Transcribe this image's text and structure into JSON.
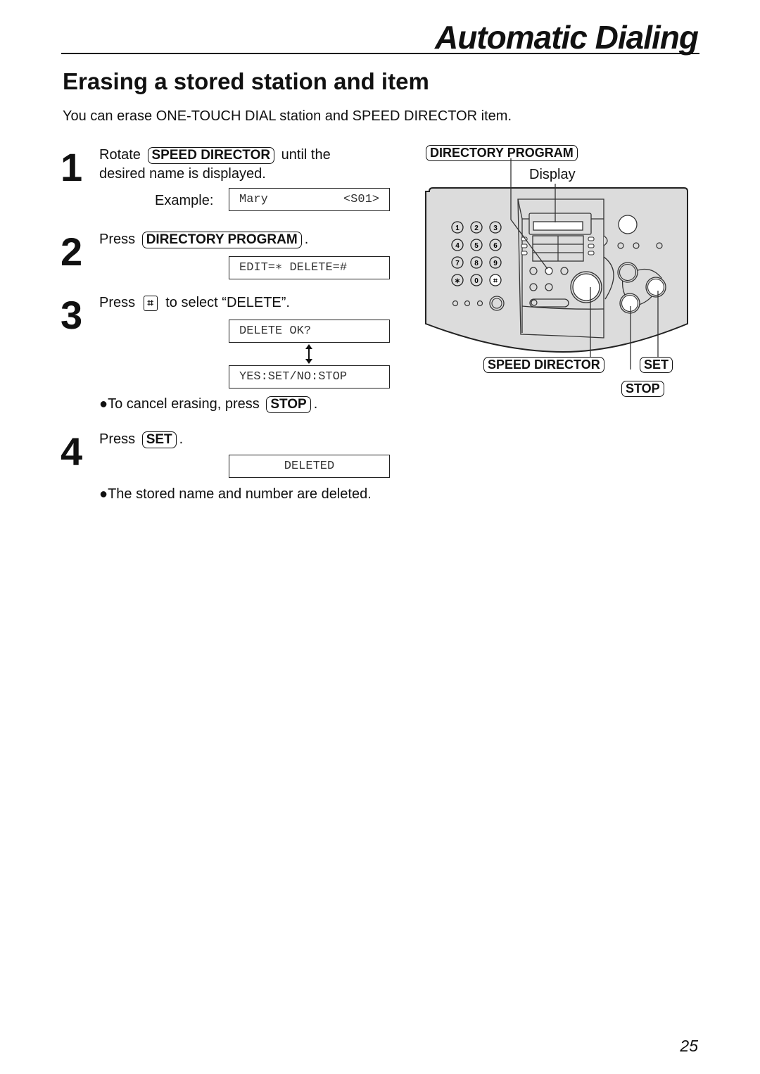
{
  "header": {
    "title": "Automatic Dialing"
  },
  "section": {
    "title": "Erasing a stored station and item",
    "intro": "You can erase ONE-TOUCH DIAL station and SPEED DIRECTOR item."
  },
  "steps": [
    {
      "number": "1",
      "text_before": "Rotate",
      "key": "SPEED DIRECTOR",
      "text_after": "until the",
      "line2": "desired name is displayed.",
      "example_label": "Example:",
      "display": {
        "left": "Mary",
        "right": "<S01>"
      }
    },
    {
      "number": "2",
      "text_before": "Press",
      "key": "DIRECTORY PROGRAM",
      "text_after": ".",
      "display": "EDIT=∗ DELETE=#"
    },
    {
      "number": "3",
      "text_before": "Press",
      "key": "⌗",
      "text_after": "to select “DELETE”.",
      "display_1": "DELETE OK?",
      "display_2": "YES:SET/NO:STOP",
      "note_before": "●To cancel erasing, press",
      "note_key": "STOP",
      "note_after": "."
    },
    {
      "number": "4",
      "text_before": "Press",
      "key": "SET",
      "text_after": ".",
      "display": "DELETED",
      "note": "●The stored name and number are deleted."
    }
  ],
  "diagram": {
    "labels": {
      "directory_program": "DIRECTORY PROGRAM",
      "display": "Display",
      "speed_director": "SPEED DIRECTOR",
      "set": "SET",
      "stop": "STOP"
    },
    "keypad": [
      "1",
      "2",
      "3",
      "4",
      "5",
      "6",
      "7",
      "8",
      "9",
      "∗",
      "0",
      "⌗"
    ],
    "panel_color": "#dcdcdc"
  },
  "page_number": "25"
}
